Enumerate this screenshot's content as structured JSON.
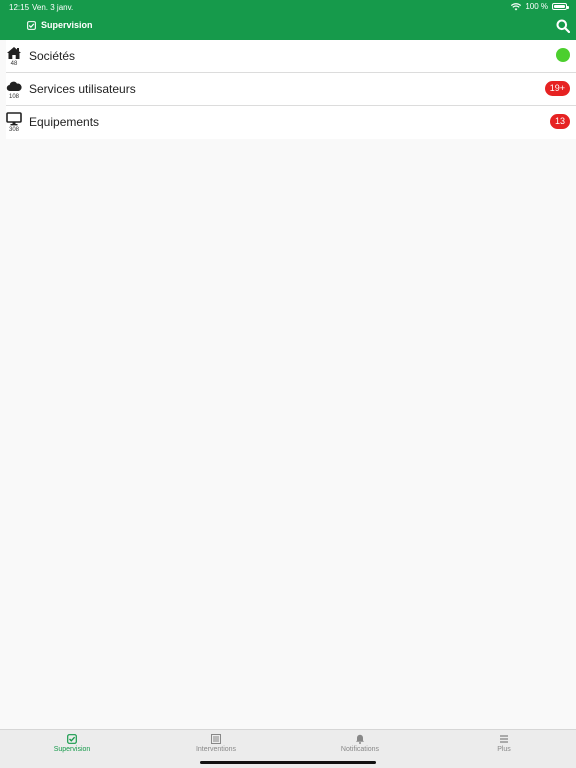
{
  "status_bar": {
    "time": "12:15",
    "date": "Ven. 3 janv.",
    "battery": "100 %"
  },
  "header": {
    "title": "Supervision",
    "icon": "checkbox-icon",
    "search_icon": "search-icon"
  },
  "colors": {
    "brand": "#169a4b",
    "badge": "#e62222",
    "ok": "#4ccf2e"
  },
  "list": {
    "items": [
      {
        "label": "Sociétés",
        "count": "48",
        "icon": "home-icon",
        "status": "ok"
      },
      {
        "label": "Services utilisateurs",
        "count": "108",
        "icon": "cloud-icon",
        "badge": "19+"
      },
      {
        "label": "Equipements",
        "count": "308",
        "icon": "monitor-icon",
        "badge": "13"
      }
    ]
  },
  "tabs": [
    {
      "label": "Supervision",
      "icon": "checkbox-icon",
      "active": true
    },
    {
      "label": "Interventions",
      "icon": "list-icon",
      "active": false
    },
    {
      "label": "Notifications",
      "icon": "bell-icon",
      "active": false
    },
    {
      "label": "Plus",
      "icon": "menu-icon",
      "active": false
    }
  ]
}
